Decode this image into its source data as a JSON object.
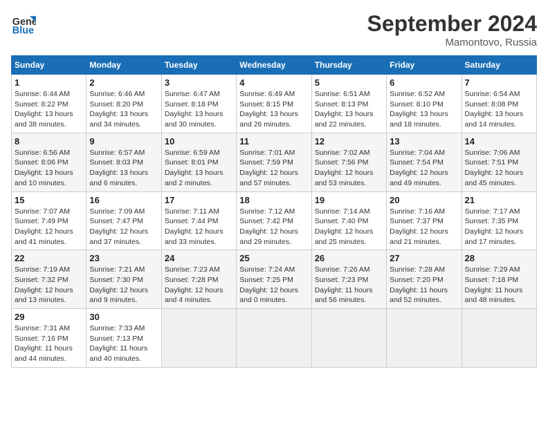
{
  "header": {
    "logo_general": "General",
    "logo_blue": "Blue",
    "month_title": "September 2024",
    "location": "Mamontovo, Russia"
  },
  "weekdays": [
    "Sunday",
    "Monday",
    "Tuesday",
    "Wednesday",
    "Thursday",
    "Friday",
    "Saturday"
  ],
  "weeks": [
    [
      {
        "day": "1",
        "info": "Sunrise: 6:44 AM\nSunset: 8:22 PM\nDaylight: 13 hours\nand 38 minutes."
      },
      {
        "day": "2",
        "info": "Sunrise: 6:46 AM\nSunset: 8:20 PM\nDaylight: 13 hours\nand 34 minutes."
      },
      {
        "day": "3",
        "info": "Sunrise: 6:47 AM\nSunset: 8:18 PM\nDaylight: 13 hours\nand 30 minutes."
      },
      {
        "day": "4",
        "info": "Sunrise: 6:49 AM\nSunset: 8:15 PM\nDaylight: 13 hours\nand 26 minutes."
      },
      {
        "day": "5",
        "info": "Sunrise: 6:51 AM\nSunset: 8:13 PM\nDaylight: 13 hours\nand 22 minutes."
      },
      {
        "day": "6",
        "info": "Sunrise: 6:52 AM\nSunset: 8:10 PM\nDaylight: 13 hours\nand 18 minutes."
      },
      {
        "day": "7",
        "info": "Sunrise: 6:54 AM\nSunset: 8:08 PM\nDaylight: 13 hours\nand 14 minutes."
      }
    ],
    [
      {
        "day": "8",
        "info": "Sunrise: 6:56 AM\nSunset: 8:06 PM\nDaylight: 13 hours\nand 10 minutes."
      },
      {
        "day": "9",
        "info": "Sunrise: 6:57 AM\nSunset: 8:03 PM\nDaylight: 13 hours\nand 6 minutes."
      },
      {
        "day": "10",
        "info": "Sunrise: 6:59 AM\nSunset: 8:01 PM\nDaylight: 13 hours\nand 2 minutes."
      },
      {
        "day": "11",
        "info": "Sunrise: 7:01 AM\nSunset: 7:59 PM\nDaylight: 12 hours\nand 57 minutes."
      },
      {
        "day": "12",
        "info": "Sunrise: 7:02 AM\nSunset: 7:56 PM\nDaylight: 12 hours\nand 53 minutes."
      },
      {
        "day": "13",
        "info": "Sunrise: 7:04 AM\nSunset: 7:54 PM\nDaylight: 12 hours\nand 49 minutes."
      },
      {
        "day": "14",
        "info": "Sunrise: 7:06 AM\nSunset: 7:51 PM\nDaylight: 12 hours\nand 45 minutes."
      }
    ],
    [
      {
        "day": "15",
        "info": "Sunrise: 7:07 AM\nSunset: 7:49 PM\nDaylight: 12 hours\nand 41 minutes."
      },
      {
        "day": "16",
        "info": "Sunrise: 7:09 AM\nSunset: 7:47 PM\nDaylight: 12 hours\nand 37 minutes."
      },
      {
        "day": "17",
        "info": "Sunrise: 7:11 AM\nSunset: 7:44 PM\nDaylight: 12 hours\nand 33 minutes."
      },
      {
        "day": "18",
        "info": "Sunrise: 7:12 AM\nSunset: 7:42 PM\nDaylight: 12 hours\nand 29 minutes."
      },
      {
        "day": "19",
        "info": "Sunrise: 7:14 AM\nSunset: 7:40 PM\nDaylight: 12 hours\nand 25 minutes."
      },
      {
        "day": "20",
        "info": "Sunrise: 7:16 AM\nSunset: 7:37 PM\nDaylight: 12 hours\nand 21 minutes."
      },
      {
        "day": "21",
        "info": "Sunrise: 7:17 AM\nSunset: 7:35 PM\nDaylight: 12 hours\nand 17 minutes."
      }
    ],
    [
      {
        "day": "22",
        "info": "Sunrise: 7:19 AM\nSunset: 7:32 PM\nDaylight: 12 hours\nand 13 minutes."
      },
      {
        "day": "23",
        "info": "Sunrise: 7:21 AM\nSunset: 7:30 PM\nDaylight: 12 hours\nand 9 minutes."
      },
      {
        "day": "24",
        "info": "Sunrise: 7:23 AM\nSunset: 7:28 PM\nDaylight: 12 hours\nand 4 minutes."
      },
      {
        "day": "25",
        "info": "Sunrise: 7:24 AM\nSunset: 7:25 PM\nDaylight: 12 hours\nand 0 minutes."
      },
      {
        "day": "26",
        "info": "Sunrise: 7:26 AM\nSunset: 7:23 PM\nDaylight: 11 hours\nand 56 minutes."
      },
      {
        "day": "27",
        "info": "Sunrise: 7:28 AM\nSunset: 7:20 PM\nDaylight: 11 hours\nand 52 minutes."
      },
      {
        "day": "28",
        "info": "Sunrise: 7:29 AM\nSunset: 7:18 PM\nDaylight: 11 hours\nand 48 minutes."
      }
    ],
    [
      {
        "day": "29",
        "info": "Sunrise: 7:31 AM\nSunset: 7:16 PM\nDaylight: 11 hours\nand 44 minutes."
      },
      {
        "day": "30",
        "info": "Sunrise: 7:33 AM\nSunset: 7:13 PM\nDaylight: 11 hours\nand 40 minutes."
      },
      null,
      null,
      null,
      null,
      null
    ]
  ]
}
